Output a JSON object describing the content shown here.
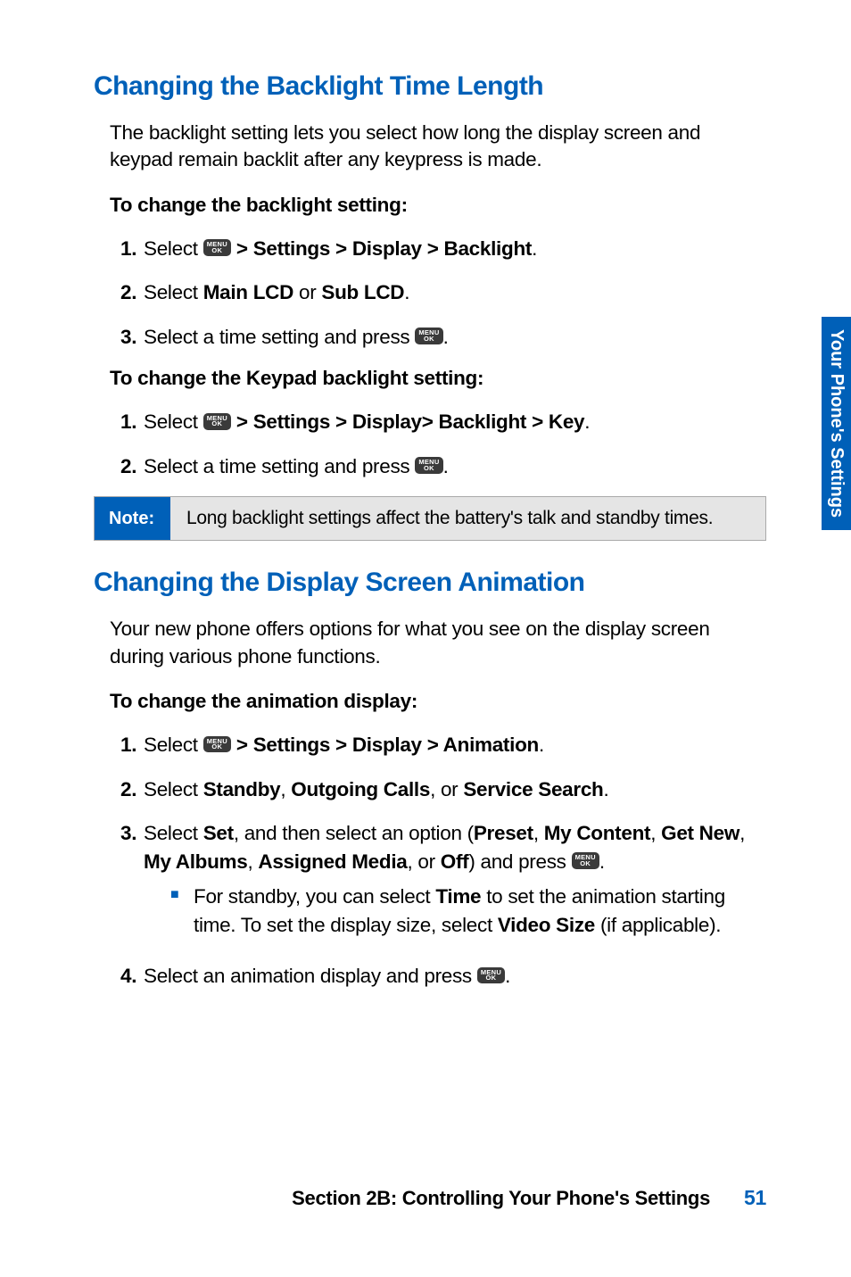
{
  "sideTab": "Your Phone's Settings",
  "section1": {
    "heading": "Changing the Backlight Time Length",
    "intro": "The backlight setting lets you select how long the display screen and keypad remain backlit after any keypress is made.",
    "subA": "To change the backlight setting:",
    "listA": {
      "i1": {
        "num": "1.",
        "pre": "Select ",
        "strong": " > Settings > Display > Backlight",
        "post": "."
      },
      "i2": {
        "num": "2.",
        "pre": "Select ",
        "s1": "Main LCD",
        "mid": " or ",
        "s2": "Sub LCD",
        "post": "."
      },
      "i3": {
        "num": "3.",
        "pre": "Select a time setting and press ",
        "post": "."
      }
    },
    "subB": "To change the Keypad backlight setting:",
    "listB": {
      "i1": {
        "num": "1.",
        "pre": "Select ",
        "strong": " > Settings > Display> Backlight > Key",
        "post": "."
      },
      "i2": {
        "num": "2.",
        "pre": "Select a time setting and press ",
        "post": "."
      }
    }
  },
  "note": {
    "label": "Note:",
    "text": "Long backlight settings affect the battery's talk and standby times."
  },
  "section2": {
    "heading": "Changing the Display Screen Animation",
    "intro": "Your new phone offers options for what you see on the display screen during various phone functions.",
    "subA": "To change the animation display:",
    "list": {
      "i1": {
        "num": "1.",
        "pre": "Select ",
        "strong": " > Settings > Display > Animation",
        "post": "."
      },
      "i2": {
        "num": "2.",
        "pre": "Select ",
        "s1": "Standby",
        "c1": ", ",
        "s2": "Outgoing Calls",
        "c2": ", or ",
        "s3": "Service Search",
        "post": "."
      },
      "i3": {
        "num": "3.",
        "pre": "Select ",
        "s1": "Set",
        "mid1": ", and then select an option (",
        "s2": "Preset",
        "c1": ", ",
        "s3": "My Content",
        "c2": ", ",
        "s4": "Get New",
        "c3": ", ",
        "s5": "My Albums",
        "c4": ", ",
        "s6": "Assigned Media",
        "c5": ", or ",
        "s7": "Off",
        "mid2": ") and press ",
        "post": ".",
        "bullet": {
          "pre": "For standby, you can select ",
          "s1": "Time",
          "mid": " to set the animation starting time. To set the display size, select ",
          "s2": "Video Size",
          "post": " (if applicable)."
        }
      },
      "i4": {
        "num": "4.",
        "pre": "Select an animation display and press ",
        "post": "."
      }
    }
  },
  "footer": {
    "text": "Section 2B: Controlling Your Phone's Settings",
    "page": "51"
  },
  "menuKey": {
    "top": "MENU",
    "bot": "OK"
  }
}
